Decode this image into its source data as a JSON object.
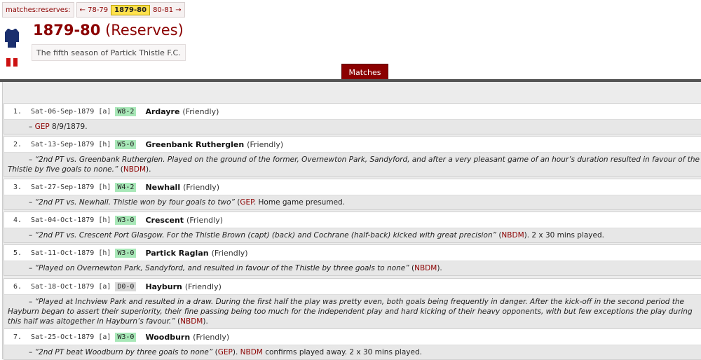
{
  "nav": {
    "label": "matches:reserves:",
    "prev": "← 78-79",
    "current": "1879-80",
    "next": "80-81 →"
  },
  "header": {
    "season": "1879-80",
    "team": "(Reserves)",
    "subtitle": "The fifth season of Partick Thistle F.C."
  },
  "tab": {
    "label": "Matches"
  },
  "matches": [
    {
      "num": "1.",
      "date": "Sat-06-Sep-1879",
      "venue": "[a]",
      "result": "W8-2",
      "opponent": "Ardayre",
      "comp": "(Friendly)",
      "note_pre": "– ",
      "note_link": "GEP",
      "note_post": " 8/9/1879."
    },
    {
      "num": "2.",
      "date": "Sat-13-Sep-1879",
      "venue": "[h]",
      "result": "W5-0",
      "opponent": "Greenbank Rutherglen",
      "comp": "(Friendly)",
      "note_quote": "“2nd PT vs. Greenbank Rutherglen. Played on the ground of the former, Overnewton Park, Sandyford, and after a very pleasant game of an hour’s duration resulted in favour of the Thistle by five goals to none.”",
      "note_link": "NBDM"
    },
    {
      "num": "3.",
      "date": "Sat-27-Sep-1879",
      "venue": "[h]",
      "result": "W4-2",
      "opponent": "Newhall",
      "comp": "(Friendly)",
      "note_quote": "“2nd PT vs. Newhall. Thistle won by four goals to two”",
      "note_link": "GEP",
      "note_post": ". Home game presumed."
    },
    {
      "num": "4.",
      "date": "Sat-04-Oct-1879",
      "venue": "[h]",
      "result": "W3-0",
      "opponent": "Crescent",
      "comp": "(Friendly)",
      "note_quote": "“2nd PT vs. Crescent Port Glasgow. For the Thistle Brown (capt) (back) and Cochrane (half-back) kicked with great precision”",
      "note_link": "NBDM",
      "note_post": ". 2 x 30 mins played."
    },
    {
      "num": "5.",
      "date": "Sat-11-Oct-1879",
      "venue": "[h]",
      "result": "W3-0",
      "opponent": "Partick Raglan",
      "comp": "(Friendly)",
      "note_quote": "“Played on Overnewton Park, Sandyford, and resulted in favour of the Thistle by three goals to none”",
      "note_link": "NBDM",
      "note_post": "."
    },
    {
      "num": "6.",
      "date": "Sat-18-Oct-1879",
      "venue": "[a]",
      "result": "D0-0",
      "opponent": "Hayburn",
      "comp": "(Friendly)",
      "note_quote": "“Played at Inchview Park and resulted in a draw. During the first half the play was pretty even, both goals being frequently in danger. After the kick-off in the second period the Hayburn began to assert their superiority, their fine passing being too much for the independent play and hard kicking of their heavy opponents, with but few exceptions the play during this half was altogether in Hayburn’s favour.”",
      "note_link": "NBDM",
      "note_post": ")."
    },
    {
      "num": "7.",
      "date": "Sat-25-Oct-1879",
      "venue": "[a]",
      "result": "W3-0",
      "opponent": "Woodburn",
      "comp": "(Friendly)",
      "note_quote": "“2nd PT beat Woodburn by three goals to none”",
      "note_link": "GEP",
      "note_mid": "). ",
      "note_link2": "NBDM",
      "note_post": " confirms played away. 2 x 30 mins played."
    }
  ],
  "colors": {
    "accent": "#8b0000",
    "win": "#a8e8b8",
    "draw": "#d8d8d8",
    "current": "#ffe14d"
  }
}
